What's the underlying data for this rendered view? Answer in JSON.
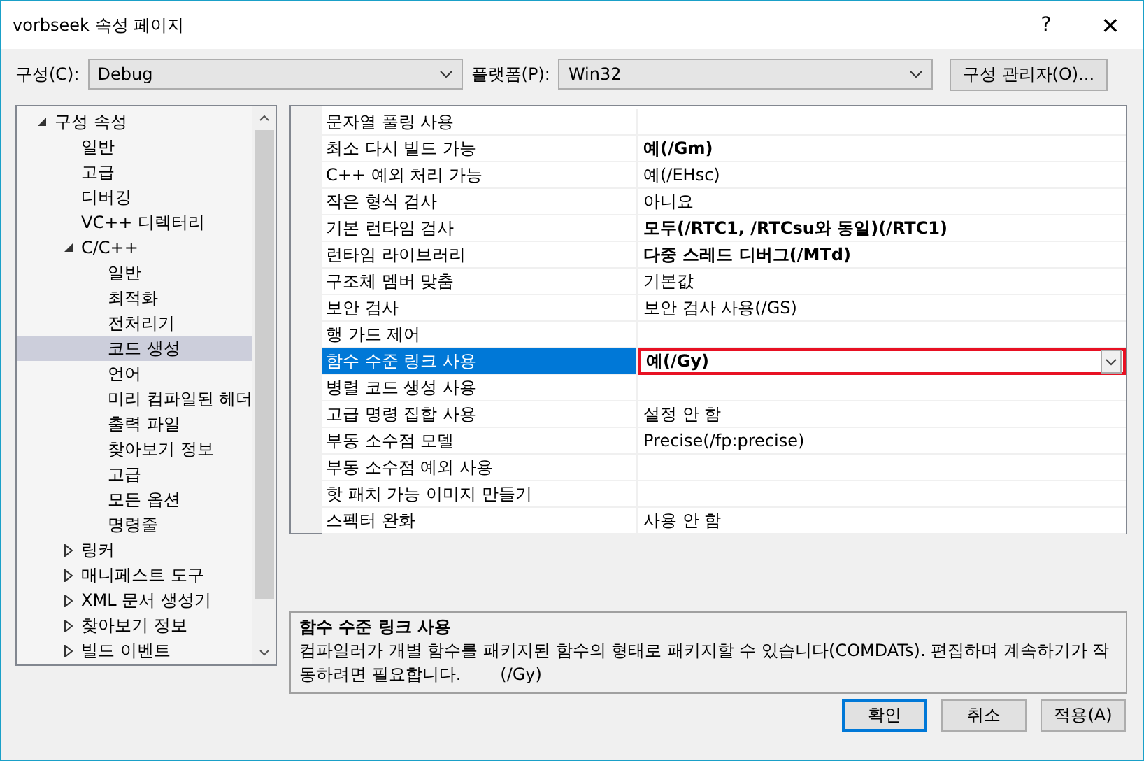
{
  "window": {
    "title": "vorbseek 속성 페이지",
    "help": "?",
    "close": "✕"
  },
  "config": {
    "label": "구성(C):",
    "value": "Debug"
  },
  "platform": {
    "label": "플랫폼(P):",
    "value": "Win32"
  },
  "manager_button": "구성 관리자(O)...",
  "tree": [
    {
      "label": "구성 속성",
      "expanded": true,
      "selected": false,
      "children": [
        {
          "label": "일반",
          "selected": false
        },
        {
          "label": "고급",
          "selected": false
        },
        {
          "label": "디버깅",
          "selected": false
        },
        {
          "label": "VC++ 디렉터리",
          "selected": false
        },
        {
          "label": "C/C++",
          "expanded": true,
          "selected": false,
          "children": [
            {
              "label": "일반",
              "selected": false
            },
            {
              "label": "최적화",
              "selected": false
            },
            {
              "label": "전처리기",
              "selected": false
            },
            {
              "label": "코드 생성",
              "selected": true
            },
            {
              "label": "언어",
              "selected": false
            },
            {
              "label": "미리 컴파일된 헤더",
              "selected": false
            },
            {
              "label": "출력 파일",
              "selected": false
            },
            {
              "label": "찾아보기 정보",
              "selected": false
            },
            {
              "label": "고급",
              "selected": false
            },
            {
              "label": "모든 옵션",
              "selected": false
            },
            {
              "label": "명령줄",
              "selected": false
            }
          ]
        },
        {
          "label": "링커",
          "expanded": false,
          "selected": false
        },
        {
          "label": "매니페스트 도구",
          "expanded": false,
          "selected": false
        },
        {
          "label": "XML 문서 생성기",
          "expanded": false,
          "selected": false
        },
        {
          "label": "찾아보기 정보",
          "expanded": false,
          "selected": false
        },
        {
          "label": "빌드 이벤트",
          "expanded": false,
          "selected": false
        }
      ]
    }
  ],
  "properties": [
    {
      "name": "문자열 풀링 사용",
      "selected": false
    },
    {
      "name": "최소 다시 빌드 가능",
      "value": "예(/Gm)",
      "bold": true,
      "selected": false
    },
    {
      "name": "C++ 예외 처리 가능",
      "value": "예(/EHsc)",
      "bold": false,
      "selected": false
    },
    {
      "name": "작은 형식 검사",
      "value": "아니요",
      "bold": false,
      "selected": false
    },
    {
      "name": "기본 런타임 검사",
      "value": "모두(/RTC1, /RTCsu와 동일)(/RTC1)",
      "bold": true,
      "selected": false
    },
    {
      "name": "런타임 라이브러리",
      "value": "다중 스레드 디버그(/MTd)",
      "bold": true,
      "selected": false
    },
    {
      "name": "구조체 멤버 맞춤",
      "value": "기본값",
      "bold": false,
      "selected": false
    },
    {
      "name": "보안 검사",
      "value": "보안 검사 사용(/GS)",
      "bold": false,
      "selected": false
    },
    {
      "name": "행 가드 제어",
      "selected": false
    },
    {
      "name": "함수 수준 링크 사용",
      "value": "예(/Gy)",
      "bold": true,
      "selected": true
    },
    {
      "name": "병렬 코드 생성 사용",
      "selected": false
    },
    {
      "name": "고급 명령 집합 사용",
      "value": "설정 안 함",
      "bold": false,
      "selected": false
    },
    {
      "name": "부동 소수점 모델",
      "value": "Precise(/fp:precise)",
      "bold": false,
      "selected": false
    },
    {
      "name": "부동 소수점 예외 사용",
      "selected": false
    },
    {
      "name": "핫 패치 가능 이미지 만들기",
      "selected": false
    },
    {
      "name": "스펙터 완화",
      "value": "사용 안 함",
      "bold": false,
      "selected": false
    }
  ],
  "description": {
    "title": "함수 수준 링크 사용",
    "text": "컴파일러가 개별 함수를 패키지된 함수의 형태로 패키지할 수 있습니다(COMDATs). 편집하며 계속하기가 작동하려면 필요합니다.",
    "flag": "(/Gy)"
  },
  "buttons": [
    {
      "label": "확인",
      "default": true
    },
    {
      "label": "취소",
      "default": false
    },
    {
      "label": "적용(A)",
      "default": false
    }
  ]
}
